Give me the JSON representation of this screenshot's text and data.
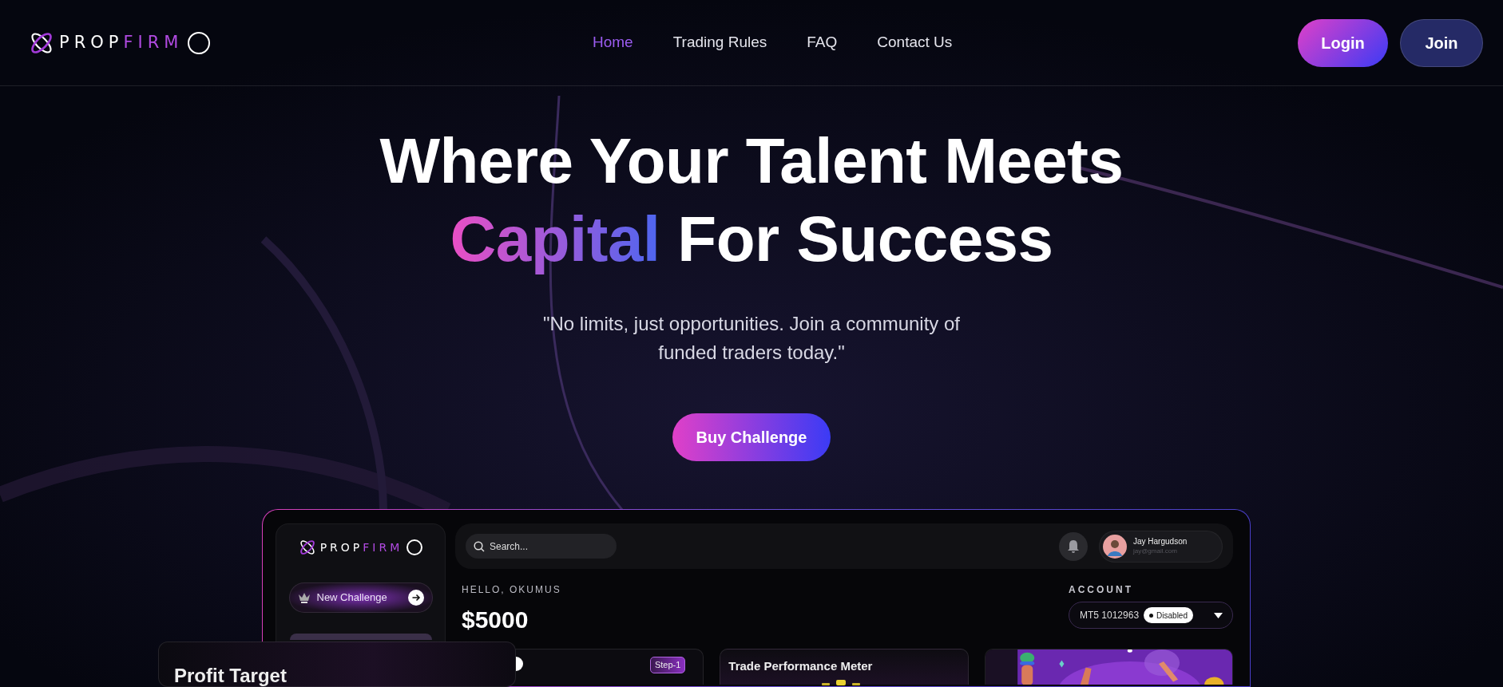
{
  "header": {
    "logo": {
      "parts": [
        "PROP",
        "FIRM"
      ]
    },
    "nav": [
      {
        "label": "Home",
        "selected": true
      },
      {
        "label": "Trading Rules",
        "selected": false
      },
      {
        "label": "FAQ",
        "selected": false
      },
      {
        "label": "Contact Us",
        "selected": false
      }
    ],
    "buttons": [
      {
        "label": "Login",
        "kind": "primary"
      },
      {
        "label": "Join",
        "kind": "secondary"
      }
    ]
  },
  "hero": {
    "title_line1": "Where Your Talent Meets",
    "title_highlight": "Capital",
    "title_rest": "For Success",
    "subtitle": "\"No limits, just opportunities. Join a community of funded traders today.\"",
    "cta": "Buy Challenge"
  },
  "dashboard": {
    "sidebar": {
      "logo": {
        "parts": [
          "PROP",
          "FIRM"
        ]
      },
      "new_challenge": "New Challenge"
    },
    "search": {
      "placeholder": "Search..."
    },
    "user": {
      "name": "Jay Hargudson",
      "email": "jay@gmail.com"
    },
    "greeting": "HELLO, OKUMUS",
    "balance": "$5000",
    "account": {
      "label": "ACCOUNT",
      "id": "MT5 1012963",
      "status": "Disabled"
    },
    "cards": [
      {
        "kind": "step",
        "badge": "Step-1"
      },
      {
        "kind": "meter",
        "title": "Trade Performance Meter"
      },
      {
        "kind": "picture"
      }
    ],
    "overlay_card": {
      "title": "Profit Target"
    }
  }
}
